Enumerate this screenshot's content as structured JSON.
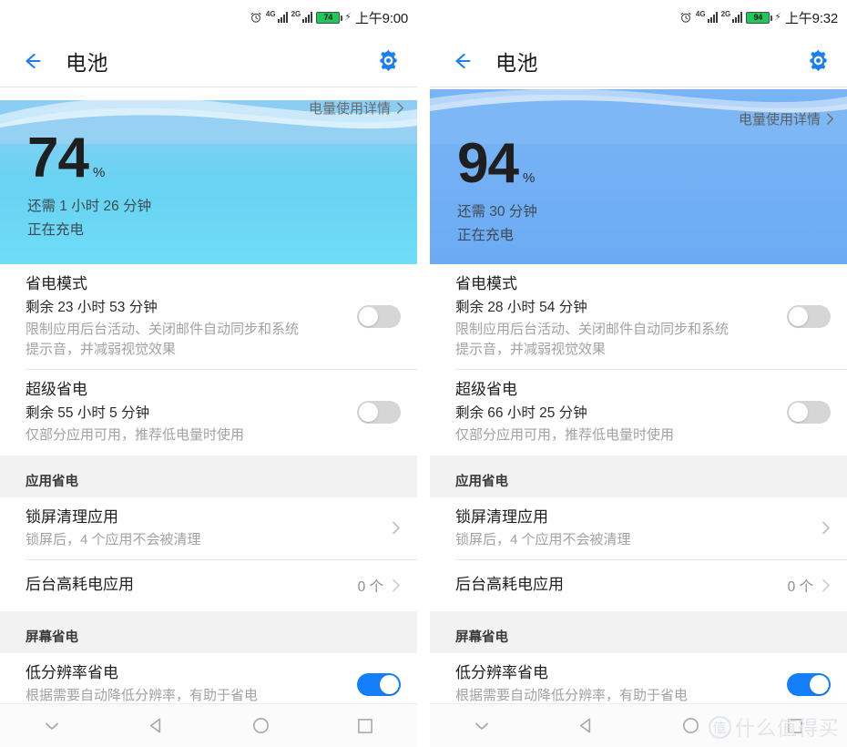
{
  "colors": {
    "accent_blue": "#157efb",
    "battery_green": "#20c75a",
    "hero_left_top": "#8ecdf3",
    "hero_left_bottom": "#6fdcf8",
    "hero_right": "#6cabf4",
    "section_bg": "#f2f2f2",
    "toggle_off": "#d6d6d6"
  },
  "panels": [
    {
      "id": "left",
      "statusbar": {
        "alarm_icon": "alarm-clock-icon",
        "sim1_label": "4G",
        "sim2_label": "2G",
        "battery_level": "74",
        "charging_icon": "charging-bolt-icon",
        "time": "上午9:00"
      },
      "appbar": {
        "back_icon": "back-arrow-icon",
        "title": "电池",
        "settings_icon": "gear-icon"
      },
      "hero": {
        "details_link": "电量使用详情",
        "chevron_icon": "chevron-right-icon",
        "percent": "74",
        "percent_symbol": "%",
        "remaining": "还需 1 小时 26 分钟",
        "status": "正在充电"
      },
      "rows": [
        {
          "name": "power-saving-mode",
          "title": "省电模式",
          "value": "剩余 23 小时 53 分钟",
          "desc": "限制应用后台活动、关闭邮件自动同步和系统\n提示音，并减弱视觉效果",
          "control": "toggle",
          "state": "off"
        },
        {
          "name": "ultra-power-saving",
          "title": "超级省电",
          "value": "剩余 55 小时 5 分钟",
          "desc": "仅部分应用可用，推荐低电量时使用",
          "control": "toggle",
          "state": "off"
        }
      ],
      "section_app": {
        "header": "应用省电",
        "rows": [
          {
            "name": "lockscreen-cleanup-apps",
            "title": "锁屏清理应用",
            "desc": "锁屏后，4 个应用不会被清理",
            "control": "chevron",
            "count": ""
          },
          {
            "name": "high-drain-background-apps",
            "title": "后台高耗电应用",
            "desc": "",
            "control": "chevron",
            "count": "0 个"
          }
        ]
      },
      "section_screen": {
        "header": "屏幕省电",
        "rows": [
          {
            "name": "low-resolution-saving",
            "title": "低分辨率省电",
            "desc": "根据需要自动降低分辨率，有助于省电",
            "control": "toggle",
            "state": "on"
          }
        ]
      },
      "navbar": [
        {
          "name": "hide-navbar-button",
          "icon": "chevron-down-icon"
        },
        {
          "name": "back-button",
          "icon": "triangle-back-icon"
        },
        {
          "name": "home-button",
          "icon": "circle-home-icon"
        },
        {
          "name": "recents-button",
          "icon": "square-recents-icon"
        }
      ]
    },
    {
      "id": "right",
      "statusbar": {
        "alarm_icon": "alarm-clock-icon",
        "sim1_label": "4G",
        "sim2_label": "2G",
        "battery_level": "94",
        "charging_icon": "charging-bolt-icon",
        "time": "上午9:32"
      },
      "appbar": {
        "back_icon": "back-arrow-icon",
        "title": "电池",
        "settings_icon": "gear-icon"
      },
      "hero": {
        "details_link": "电量使用详情",
        "chevron_icon": "chevron-right-icon",
        "percent": "94",
        "percent_symbol": "%",
        "remaining": "还需 30 分钟",
        "status": "正在充电"
      },
      "rows": [
        {
          "name": "power-saving-mode",
          "title": "省电模式",
          "value": "剩余 28 小时 54 分钟",
          "desc": "限制应用后台活动、关闭邮件自动同步和系统\n提示音，并减弱视觉效果",
          "control": "toggle",
          "state": "off"
        },
        {
          "name": "ultra-power-saving",
          "title": "超级省电",
          "value": "剩余 66 小时 25 分钟",
          "desc": "仅部分应用可用，推荐低电量时使用",
          "control": "toggle",
          "state": "off"
        }
      ],
      "section_app": {
        "header": "应用省电",
        "rows": [
          {
            "name": "lockscreen-cleanup-apps",
            "title": "锁屏清理应用",
            "desc": "锁屏后，4 个应用不会被清理",
            "control": "chevron",
            "count": ""
          },
          {
            "name": "high-drain-background-apps",
            "title": "后台高耗电应用",
            "desc": "",
            "control": "chevron",
            "count": "0 个"
          }
        ]
      },
      "section_screen": {
        "header": "屏幕省电",
        "rows": [
          {
            "name": "low-resolution-saving",
            "title": "低分辨率省电",
            "desc": "根据需要自动降低分辨率，有助于省电",
            "control": "toggle",
            "state": "on"
          }
        ]
      },
      "navbar": [
        {
          "name": "hide-navbar-button",
          "icon": "chevron-down-icon"
        },
        {
          "name": "back-button",
          "icon": "triangle-back-icon"
        },
        {
          "name": "home-button",
          "icon": "circle-home-icon"
        },
        {
          "name": "recents-button",
          "icon": "square-recents-icon"
        }
      ]
    }
  ],
  "watermark": {
    "badge": "值",
    "text": "什么值得买"
  }
}
